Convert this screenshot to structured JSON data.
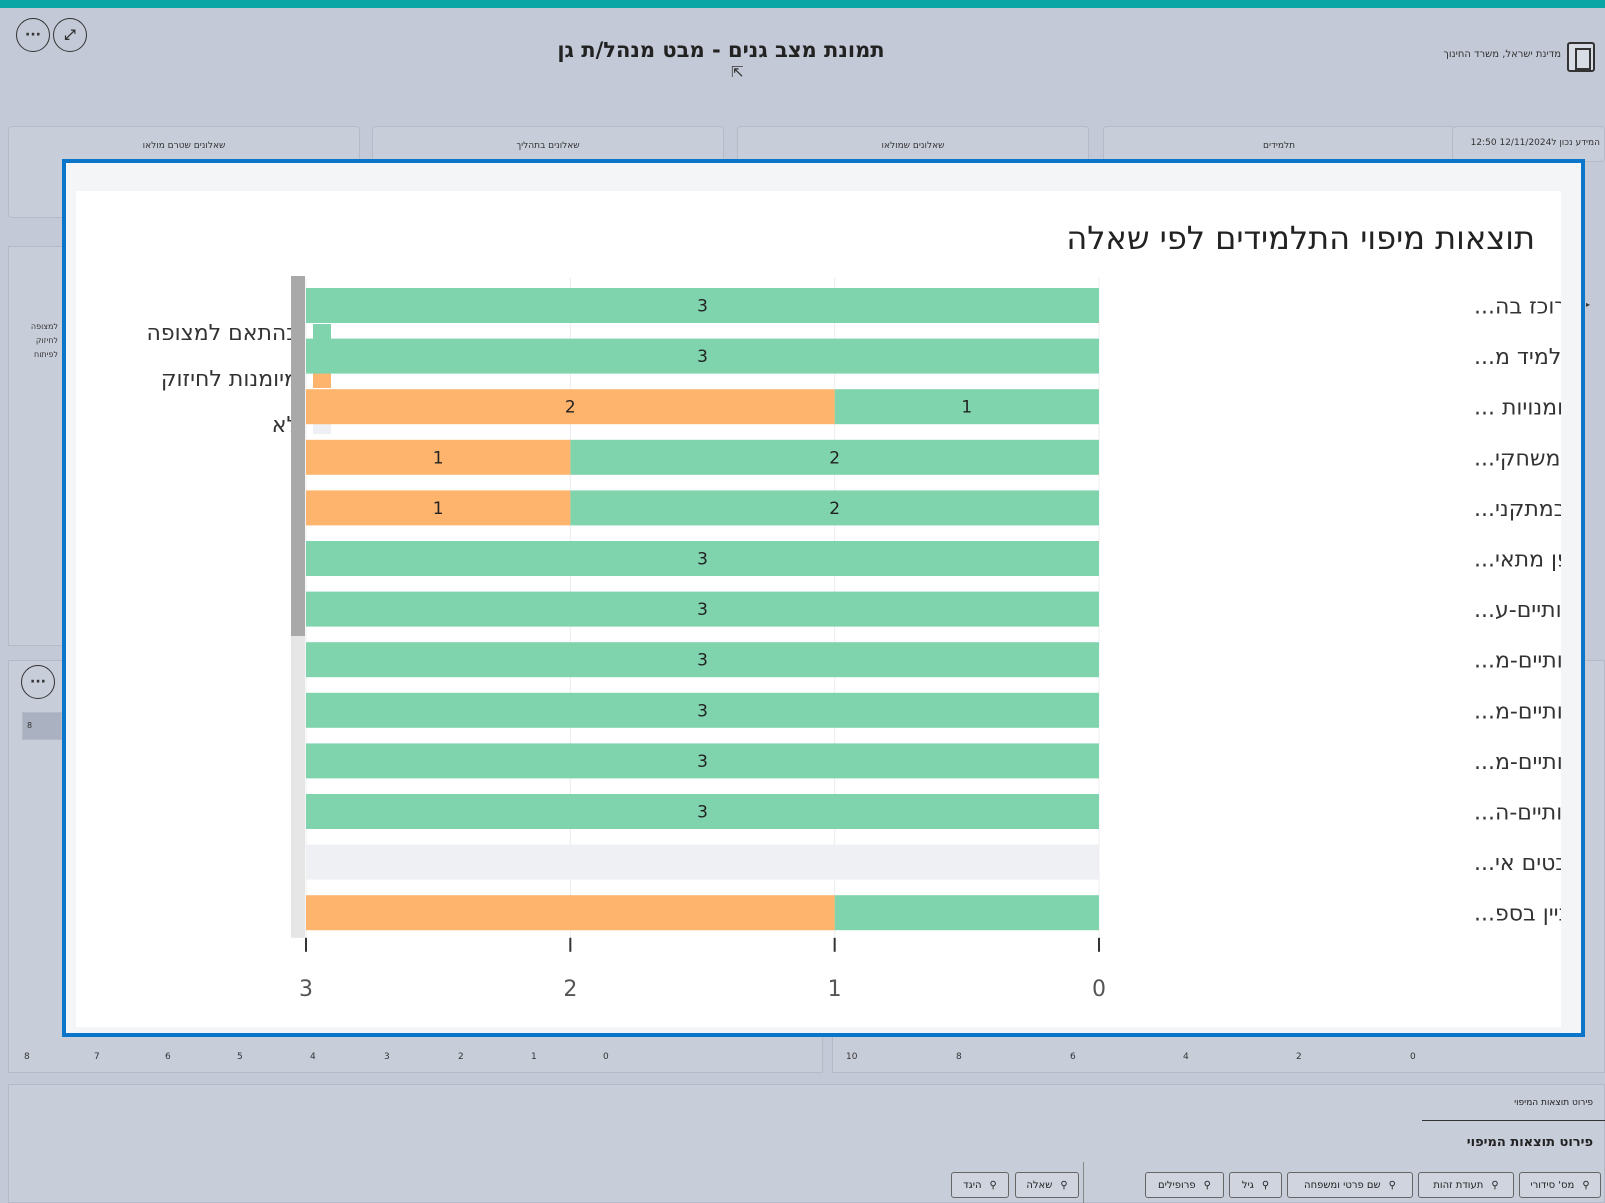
{
  "header": {
    "report_title": "תמונת מצב גנים - מבט מנהל/ת גן",
    "org_name": "מדינת ישראל, משרד החינוך",
    "more_icon": "ellipsis-icon",
    "expand_icon": "expand-icon"
  },
  "cards": [
    {
      "label": "שאלונים שטרם מולאו"
    },
    {
      "label": "שאלונים בתהליך"
    },
    {
      "label": "שאלונים שמולאו"
    },
    {
      "label": "תלמידים"
    }
  ],
  "updated_text": "המידע נכון ל12/11/2024 12:50",
  "background": {
    "left_side_labels": [
      "למצופה",
      "לחיזוק",
      "לפיתוח"
    ],
    "left_axis_ticks": [
      "8",
      "7",
      "6",
      "5",
      "4",
      "3",
      "2",
      "1",
      "0"
    ],
    "right_axis_ticks": [
      "10",
      "8",
      "6",
      "4",
      "2",
      "0"
    ],
    "small_box_label": "8"
  },
  "mapping": {
    "section_title_small": "פירוט תוצאות המיפוי",
    "section_title_big": "פירוט תוצאות המיפוי",
    "filters_right": [
      "מס' סידורי",
      "תעודת זהות",
      "שם פרטי ומשפחה",
      "גיל",
      "פרופילים"
    ],
    "filters_left": [
      "שאלה",
      "היגד"
    ],
    "search_icon": "search-icon"
  },
  "focus": {
    "title": "תוצאות מיפוי התלמידים לפי שאלה",
    "legend": [
      {
        "name": "בהתאם למצופה",
        "color": "#7fd4ae"
      },
      {
        "name": "מיומנות לחיזוק",
        "color": "#ffb46d"
      },
      {
        "name": "לא",
        "color": "#eef0f3"
      }
    ]
  },
  "chart_data": {
    "type": "bar",
    "orientation": "horizontal",
    "stacked": true,
    "x_reversed": true,
    "xlim": [
      0,
      3
    ],
    "x_ticks": [
      "3",
      "2",
      "1",
      "0"
    ],
    "grid": true,
    "legend_position": "left",
    "categories": [
      "תפקודי קשב-קשוב ומרוכז בה...",
      "תחומי עניין וחוזקות-התלמיד מ...",
      "חושי-תנועתי-שולט במיומנויות ...",
      "חושי-תנועתי-משתתף במשחקי...",
      "חושי-תנועתי-משתמש במתקני...",
      "חושי-תנועתי-מגיב באופן מתאי...",
      "היבטים רגשיים-התנהגותיים-ע...",
      "היבטים רגשיים-התנהגותיים-מ...",
      "היבטים רגשיים-התנהגותיים-מ...",
      "היבטים רגשיים-התנהגותיים-מ...",
      "היבטים רגשיים-התנהגותיים-ה...",
      "היבטים משפחתיים-היבטים אי...",
      "היבטים לימודיים-מתעניין בספ..."
    ],
    "series": [
      {
        "name": "בהתאם למצופה",
        "color": "#7fd4ae",
        "values": [
          3,
          3,
          1,
          2,
          2,
          3,
          3,
          3,
          3,
          3,
          3,
          0,
          1
        ],
        "labels": [
          "3",
          "3",
          "1",
          "2",
          "2",
          "3",
          "3",
          "3",
          "3",
          "3",
          "3",
          "",
          ""
        ]
      },
      {
        "name": "מיומנות לחיזוק",
        "color": "#ffb46d",
        "values": [
          0,
          0,
          2,
          1,
          1,
          0,
          0,
          0,
          0,
          0,
          0,
          0,
          2
        ],
        "labels": [
          "",
          "",
          "2",
          "1",
          "1",
          "",
          "",
          "",
          "",
          "",
          "",
          "",
          ""
        ]
      },
      {
        "name": "לא",
        "color": "#eef0f3",
        "values": [
          0,
          0,
          0,
          0,
          0,
          0,
          0,
          0,
          0,
          0,
          0,
          3,
          0
        ],
        "labels": [
          "",
          "",
          "",
          "",
          "",
          "",
          "",
          "",
          "",
          "",
          "",
          "",
          ""
        ]
      }
    ]
  }
}
